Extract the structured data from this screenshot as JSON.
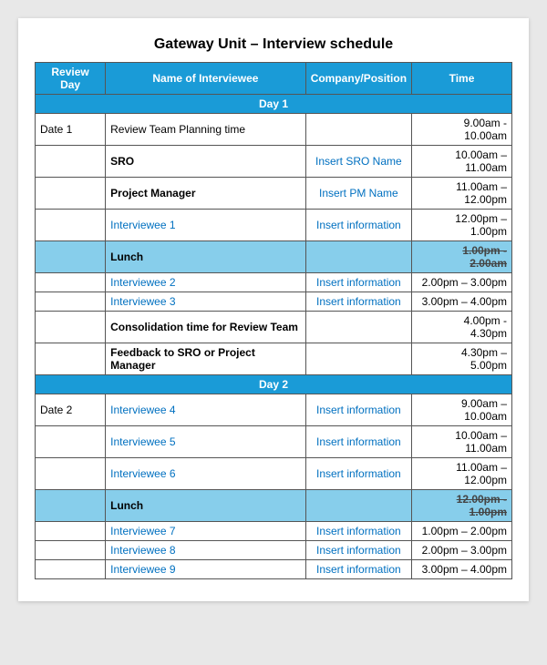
{
  "title": "Gateway Unit – Interview schedule",
  "header": {
    "col1": "Review Day",
    "col2": "Name of Interviewee",
    "col3": "Company/Position",
    "col4": "Time"
  },
  "rows": [
    {
      "type": "day-header",
      "label": "Day 1"
    },
    {
      "type": "data",
      "col1": "Date 1",
      "col2": "Review Team Planning time",
      "col2_style": "normal",
      "col3": "",
      "col4": "9.00am -\n10.00am"
    },
    {
      "type": "data",
      "col1": "",
      "col2": "SRO",
      "col2_style": "bold",
      "col3": "Insert SRO Name",
      "col3_style": "insert",
      "col4": "10.00am –\n11.00am"
    },
    {
      "type": "data",
      "col1": "",
      "col2": "Project Manager",
      "col2_style": "bold",
      "col3": "Insert PM Name",
      "col3_style": "insert",
      "col4": "11.00am –\n12.00pm"
    },
    {
      "type": "data",
      "col1": "",
      "col2": "Interviewee 1",
      "col2_style": "interviewee",
      "col3": "Insert information",
      "col3_style": "insert",
      "col4": "12.00pm – 1.00pm"
    },
    {
      "type": "lunch",
      "col1": "",
      "col2": "Lunch",
      "col3": "",
      "col4_strike": "1.00pm -\n2.00am"
    },
    {
      "type": "data",
      "col1": "",
      "col2": "Interviewee 2",
      "col2_style": "interviewee",
      "col3": "Insert information",
      "col3_style": "insert",
      "col4": "2.00pm – 3.00pm"
    },
    {
      "type": "data",
      "col1": "",
      "col2": "Interviewee 3",
      "col2_style": "interviewee",
      "col3": "Insert information",
      "col3_style": "insert",
      "col4": "3.00pm – 4.00pm"
    },
    {
      "type": "data",
      "col1": "",
      "col2": "Consolidation time for Review Team",
      "col2_style": "bold",
      "col3": "",
      "col4": "4.00pm -\n4.30pm"
    },
    {
      "type": "data",
      "col1": "",
      "col2": "Feedback to SRO or Project Manager",
      "col2_style": "bold",
      "col3": "",
      "col4": "4.30pm –\n5.00pm"
    },
    {
      "type": "day-header",
      "label": "Day 2"
    },
    {
      "type": "data",
      "col1": "Date 2",
      "col2": "Interviewee 4",
      "col2_style": "interviewee",
      "col3": "Insert information",
      "col3_style": "insert",
      "col4": "9.00am – 10.00am"
    },
    {
      "type": "data",
      "col1": "",
      "col2": "Interviewee 5",
      "col2_style": "interviewee",
      "col3": "Insert information",
      "col3_style": "insert",
      "col4": "10.00am –\n11.00am"
    },
    {
      "type": "data",
      "col1": "",
      "col2": "Interviewee 6",
      "col2_style": "interviewee",
      "col3": "Insert information",
      "col3_style": "insert",
      "col4": "11.00am –\n12.00pm"
    },
    {
      "type": "lunch",
      "col1": "",
      "col2": "Lunch",
      "col3": "",
      "col4_strike": "12.00pm -\n1.00pm"
    },
    {
      "type": "data",
      "col1": "",
      "col2": "Interviewee 7",
      "col2_style": "interviewee",
      "col3": "Insert information",
      "col3_style": "insert",
      "col4": "1.00pm – 2.00pm"
    },
    {
      "type": "data",
      "col1": "",
      "col2": "Interviewee 8",
      "col2_style": "interviewee",
      "col3": "Insert information",
      "col3_style": "insert",
      "col4": "2.00pm – 3.00pm"
    },
    {
      "type": "data",
      "col1": "",
      "col2": "Interviewee 9",
      "col2_style": "interviewee",
      "col3": "Insert information",
      "col3_style": "insert",
      "col4": "3.00pm – 4.00pm"
    }
  ]
}
